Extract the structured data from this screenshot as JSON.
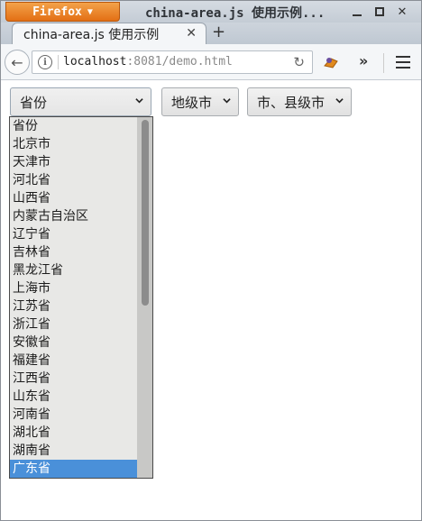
{
  "window": {
    "app_button": "Firefox",
    "title": "china-area.js 使用示例..."
  },
  "tab": {
    "title": "china-area.js 使用示例"
  },
  "nav": {
    "url_host": "localhost",
    "url_rest": ":8081/demo.html"
  },
  "selects": {
    "province": "省份",
    "city": "地级市",
    "county": "市、县级市"
  },
  "dropdown": {
    "options": [
      "省份",
      "北京市",
      "天津市",
      "河北省",
      "山西省",
      "内蒙古自治区",
      "辽宁省",
      "吉林省",
      "黑龙江省",
      "上海市",
      "江苏省",
      "浙江省",
      "安徽省",
      "福建省",
      "江西省",
      "山东省",
      "河南省",
      "湖北省",
      "湖南省",
      "广东省"
    ],
    "highlighted": "广东省"
  },
  "colors": {
    "firefox_orange": "#e36f14",
    "highlight": "#4a90d9"
  },
  "icons": [
    "chevron-down-icon",
    "minimize-icon",
    "maximize-icon",
    "close-icon",
    "new-tab-icon",
    "back-icon",
    "info-icon",
    "reload-icon",
    "extension-icon",
    "overflow-icon",
    "menu-icon"
  ]
}
